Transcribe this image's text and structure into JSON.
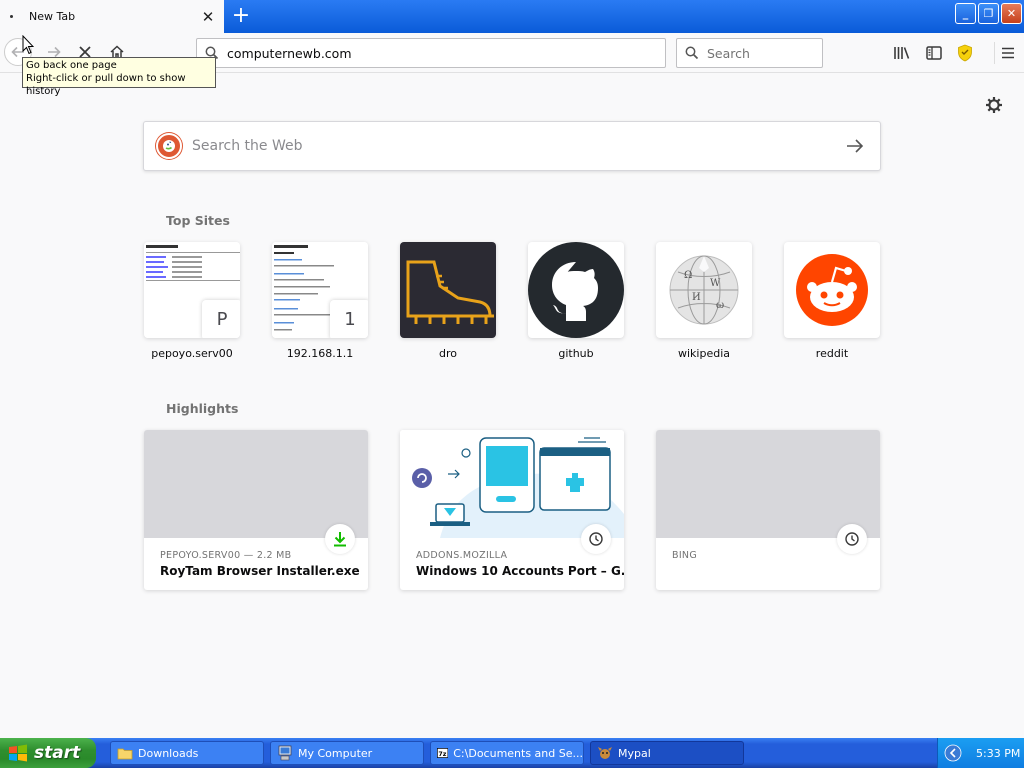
{
  "browser": {
    "tab_title": "New Tab",
    "url": "computernewb.com",
    "search_placeholder": "Search",
    "tooltip_line1": "Go back one page",
    "tooltip_line2": "Right-click or pull down to show history"
  },
  "newtab": {
    "websearch_placeholder": "Search the Web",
    "top_sites_title": "Top Sites",
    "highlights_title": "Highlights",
    "top_sites": [
      {
        "label": "pepoyo.serv00",
        "letter": "P"
      },
      {
        "label": "192.168.1.1",
        "letter": "1"
      },
      {
        "label": "dro"
      },
      {
        "label": "github"
      },
      {
        "label": "wikipedia"
      },
      {
        "label": "reddit"
      }
    ],
    "highlights": [
      {
        "meta": "PEPOYO.SERV00 — 2.2 MB",
        "title": "RoyTam Browser Installer.exe",
        "badge": "download-icon"
      },
      {
        "meta": "ADDONS.MOZILLA",
        "title": "Windows 10 Accounts Port – G...",
        "badge": "clock-icon"
      },
      {
        "meta": "BING",
        "title": "",
        "badge": "clock-icon"
      }
    ]
  },
  "taskbar": {
    "start_label": "start",
    "tasks": [
      {
        "label": "Downloads",
        "icon": "folder-icon"
      },
      {
        "label": "My Computer",
        "icon": "computer-icon"
      },
      {
        "label": "C:\\Documents and Se...",
        "icon": "7zip-icon"
      },
      {
        "label": "Mypal",
        "icon": "mypal-icon"
      }
    ],
    "clock": "5:33 PM"
  },
  "colors": {
    "titlebar": "#0a5bd8",
    "reddit": "#ff4500",
    "github": "#24292e",
    "download_green": "#12bc00"
  }
}
